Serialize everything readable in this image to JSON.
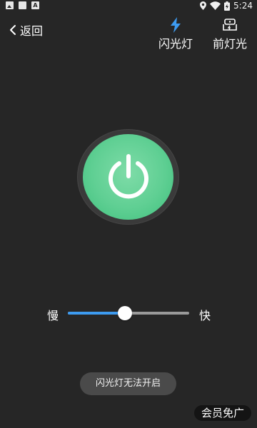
{
  "status_bar": {
    "time": "5:24",
    "left_icons": [
      "photo-icon",
      "square-icon",
      "letter-a-icon"
    ],
    "right_icons": [
      "location-icon",
      "wifi-icon",
      "battery-icon"
    ]
  },
  "header": {
    "back_label": "返回",
    "modes": [
      {
        "label": "闪光灯",
        "icon": "lightning-icon",
        "active": true,
        "color": "#3d9bf0"
      },
      {
        "label": "前灯光",
        "icon": "front-light-icon",
        "active": false,
        "color": "#ffffff"
      }
    ]
  },
  "power": {
    "icon": "power-icon",
    "color": "#5fcf93"
  },
  "speed": {
    "slow_label": "慢",
    "fast_label": "快",
    "value_fraction": 0.47,
    "fill_color": "#3d9bf0"
  },
  "toast": {
    "text": "闪光灯无法开启"
  },
  "member_badge": {
    "text": "会员免广"
  }
}
